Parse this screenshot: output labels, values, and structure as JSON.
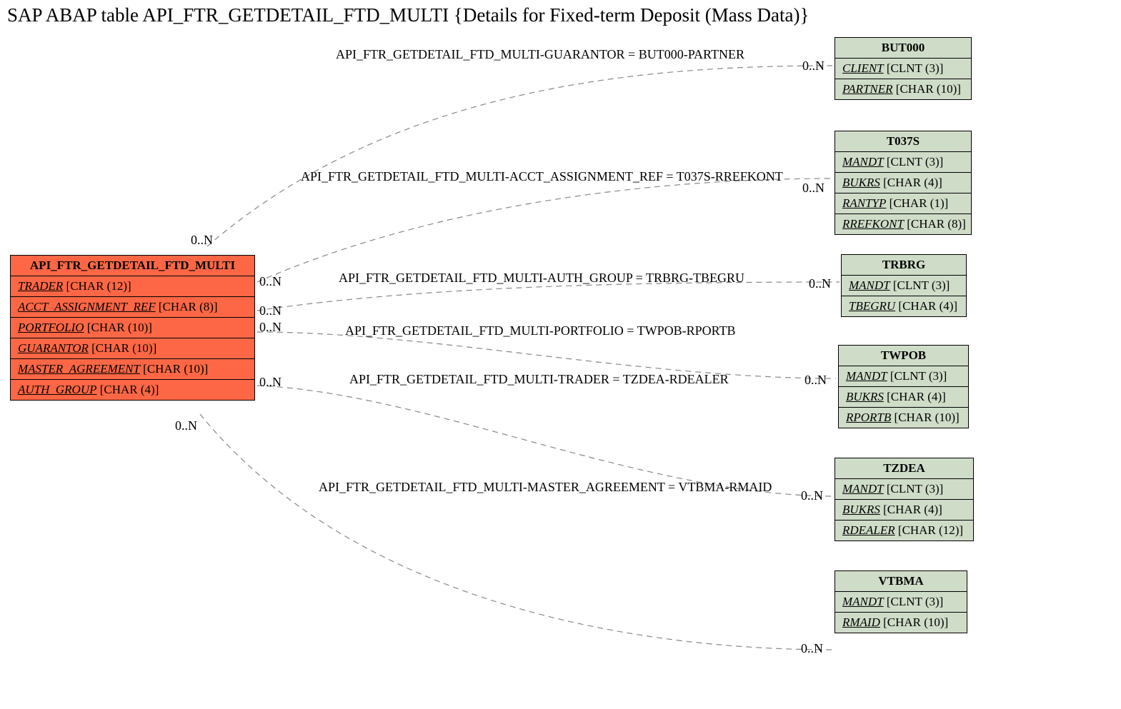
{
  "title": "SAP ABAP table API_FTR_GETDETAIL_FTD_MULTI {Details for Fixed-term Deposit (Mass Data)}",
  "main": {
    "name": "API_FTR_GETDETAIL_FTD_MULTI",
    "fields": [
      {
        "name": "TRADER",
        "type": "[CHAR (12)]"
      },
      {
        "name": "ACCT_ASSIGNMENT_REF",
        "type": "[CHAR (8)]"
      },
      {
        "name": "PORTFOLIO",
        "type": "[CHAR (10)]"
      },
      {
        "name": "GUARANTOR",
        "type": "[CHAR (10)]"
      },
      {
        "name": "MASTER_AGREEMENT",
        "type": "[CHAR (10)]"
      },
      {
        "name": "AUTH_GROUP",
        "type": "[CHAR (4)]"
      }
    ]
  },
  "refs": {
    "but000": {
      "name": "BUT000",
      "fields": [
        {
          "name": "CLIENT",
          "type": "[CLNT (3)]"
        },
        {
          "name": "PARTNER",
          "type": "[CHAR (10)]"
        }
      ]
    },
    "t037s": {
      "name": "T037S",
      "fields": [
        {
          "name": "MANDT",
          "type": "[CLNT (3)]"
        },
        {
          "name": "BUKRS",
          "type": "[CHAR (4)]"
        },
        {
          "name": "RANTYP",
          "type": "[CHAR (1)]"
        },
        {
          "name": "RREFKONT",
          "type": "[CHAR (8)]"
        }
      ]
    },
    "trbrg": {
      "name": "TRBRG",
      "fields": [
        {
          "name": "MANDT",
          "type": "[CLNT (3)]"
        },
        {
          "name": "TBEGRU",
          "type": "[CHAR (4)]"
        }
      ]
    },
    "twpob": {
      "name": "TWPOB",
      "fields": [
        {
          "name": "MANDT",
          "type": "[CLNT (3)]"
        },
        {
          "name": "BUKRS",
          "type": "[CHAR (4)]"
        },
        {
          "name": "RPORTB",
          "type": "[CHAR (10)]"
        }
      ]
    },
    "tzdea": {
      "name": "TZDEA",
      "fields": [
        {
          "name": "MANDT",
          "type": "[CLNT (3)]"
        },
        {
          "name": "BUKRS",
          "type": "[CHAR (4)]"
        },
        {
          "name": "RDEALER",
          "type": "[CHAR (12)]"
        }
      ]
    },
    "vtbma": {
      "name": "VTBMA",
      "fields": [
        {
          "name": "MANDT",
          "type": "[CLNT (3)]"
        },
        {
          "name": "RMAID",
          "type": "[CHAR (10)]"
        }
      ]
    }
  },
  "rels": {
    "r1": "API_FTR_GETDETAIL_FTD_MULTI-GUARANTOR = BUT000-PARTNER",
    "r2": "API_FTR_GETDETAIL_FTD_MULTI-ACCT_ASSIGNMENT_REF = T037S-RREFKONT",
    "r3": "API_FTR_GETDETAIL_FTD_MULTI-AUTH_GROUP = TRBRG-TBEGRU",
    "r4": "API_FTR_GETDETAIL_FTD_MULTI-PORTFOLIO = TWPOB-RPORTB",
    "r5": "API_FTR_GETDETAIL_FTD_MULTI-TRADER = TZDEA-RDEALER",
    "r6": "API_FTR_GETDETAIL_FTD_MULTI-MASTER_AGREEMENT = VTBMA-RMAID"
  },
  "card": "0..N"
}
